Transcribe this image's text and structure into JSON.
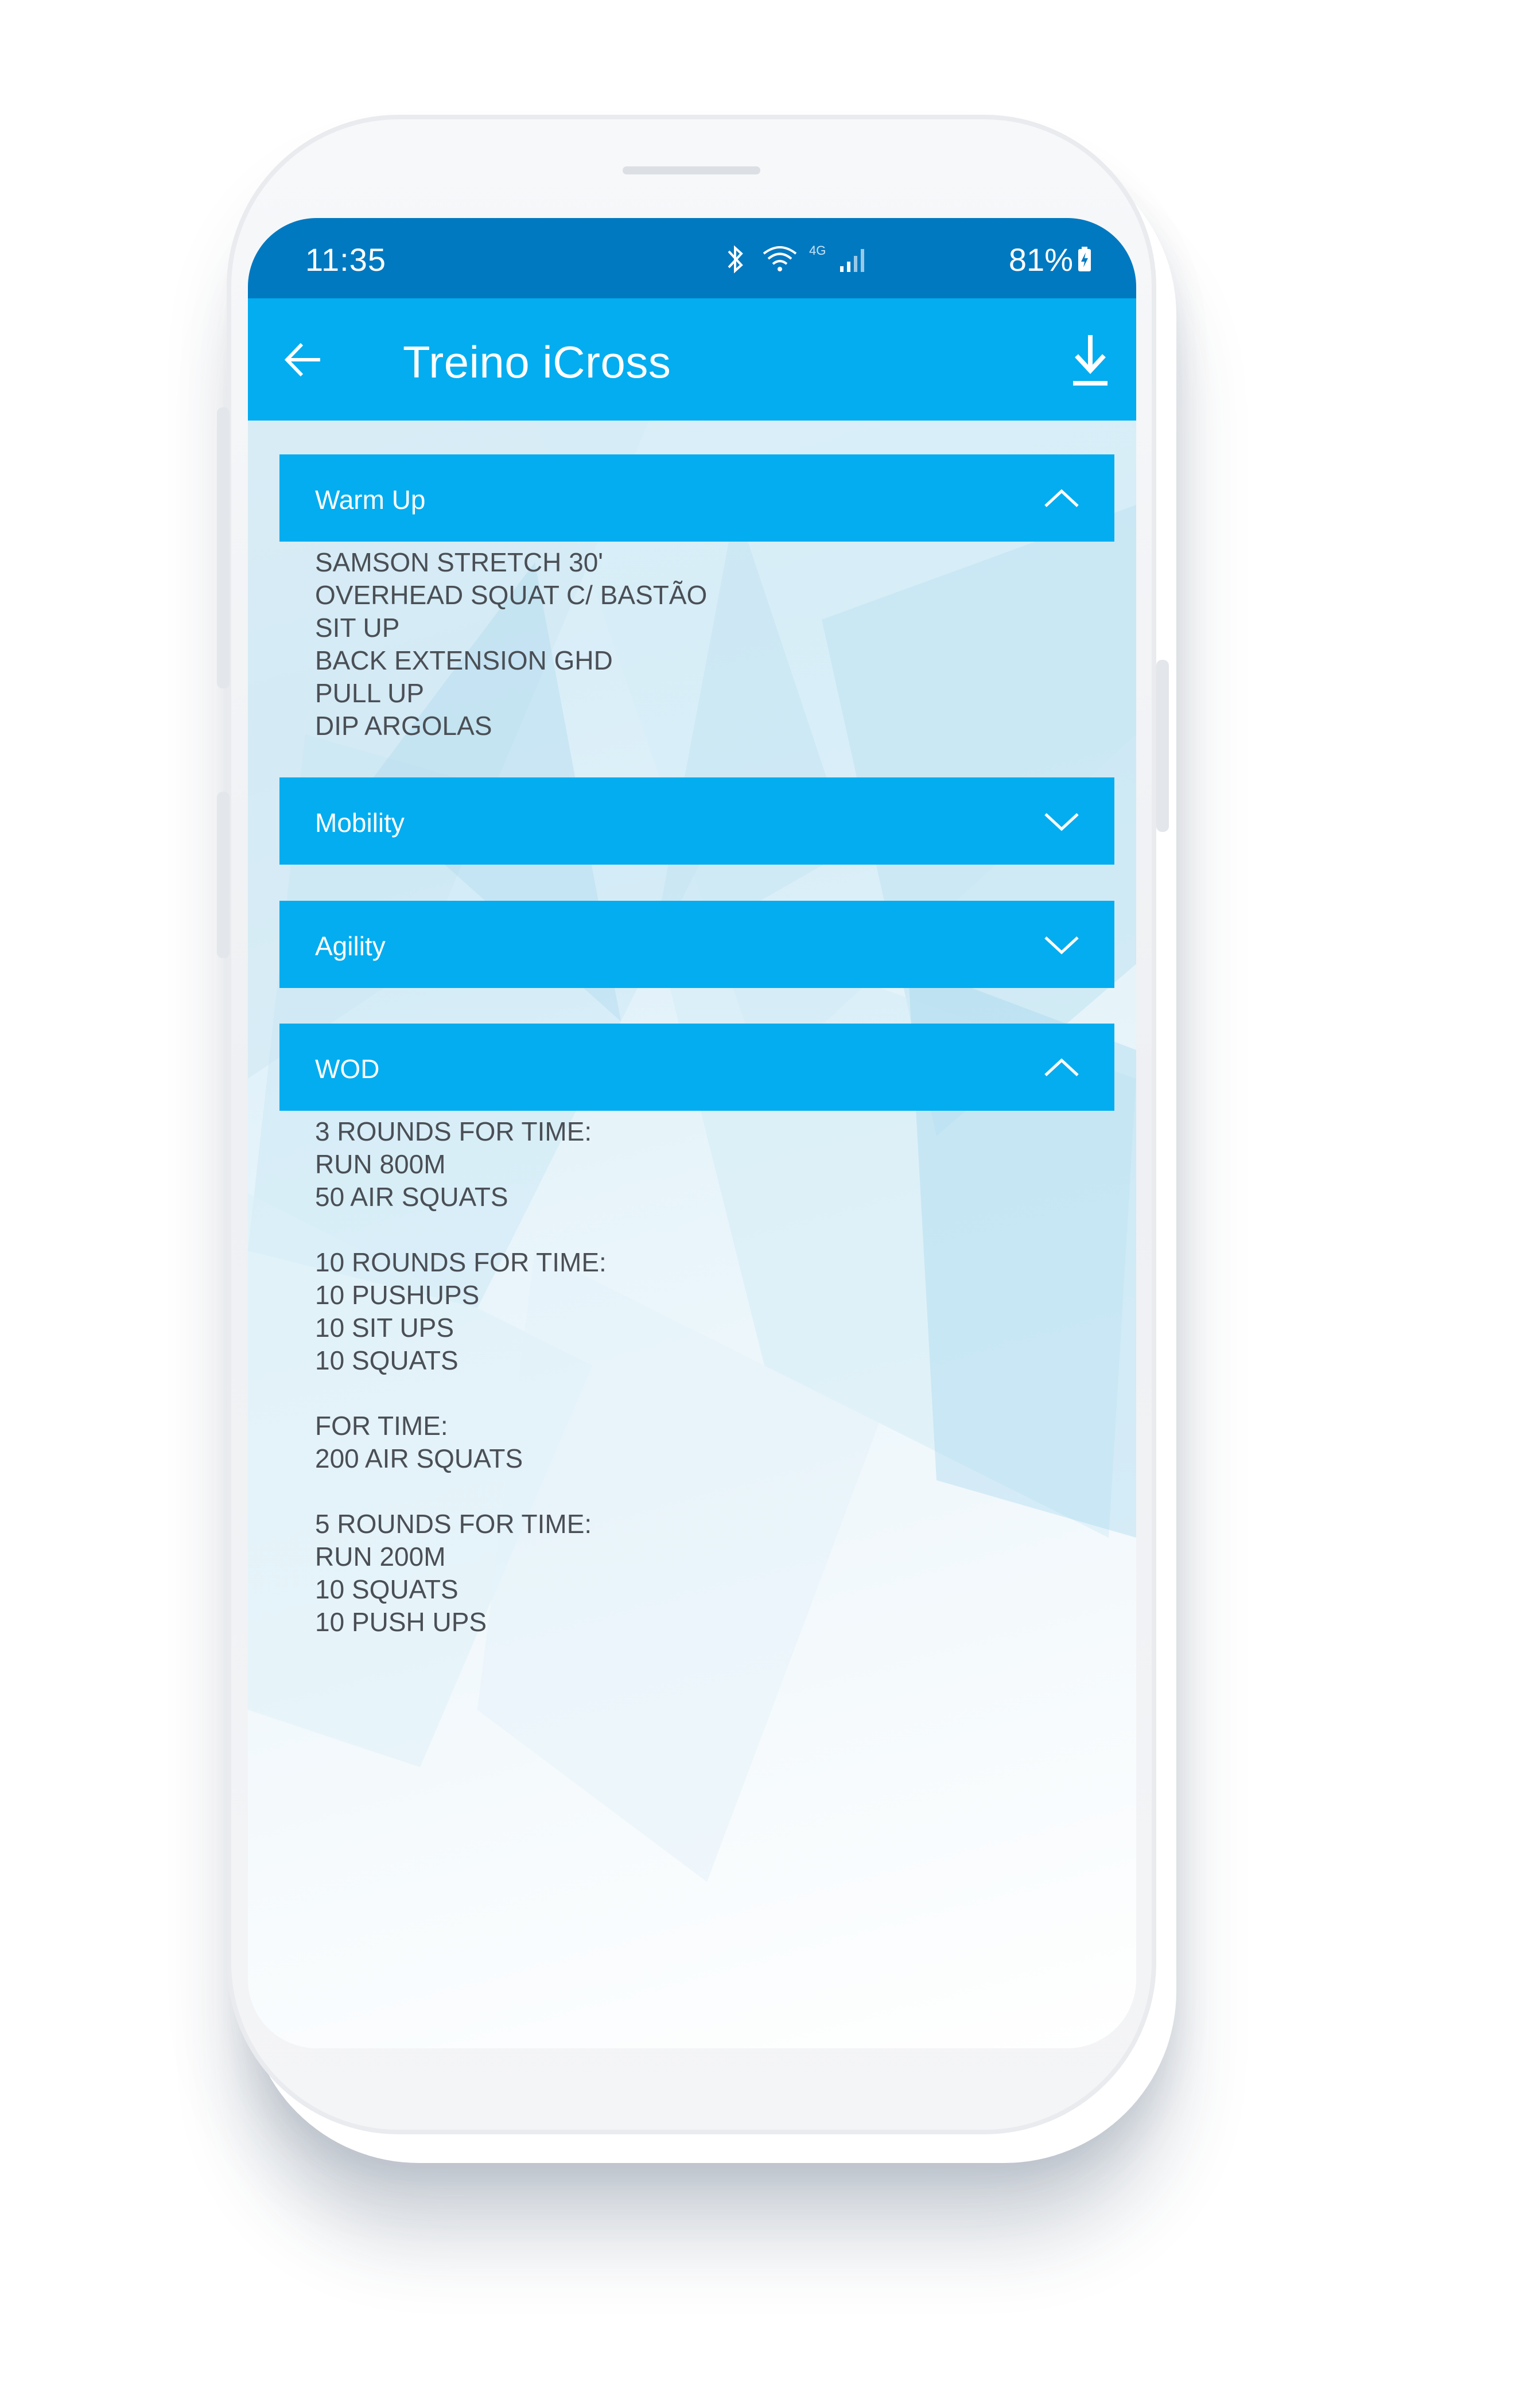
{
  "status_bar": {
    "time": "11:35",
    "network": "4G",
    "battery": "81%"
  },
  "app_bar": {
    "title": "Treino iCross",
    "back_icon": "arrow-left-icon",
    "action_icon": "download-icon"
  },
  "sections": [
    {
      "title": "Warm Up",
      "expanded": true,
      "lines": [
        "SAMSON STRETCH 30'",
        "OVERHEAD SQUAT C/ BASTÃO",
        "SIT UP",
        "BACK EXTENSION GHD",
        "PULL UP",
        "DIP ARGOLAS"
      ]
    },
    {
      "title": "Mobility",
      "expanded": false,
      "lines": []
    },
    {
      "title": "Agility",
      "expanded": false,
      "lines": []
    },
    {
      "title": "WOD",
      "expanded": true,
      "lines": [
        "3 ROUNDS FOR TIME:",
        "RUN 800M",
        "50 AIR SQUATS",
        "",
        "10 ROUNDS FOR TIME:",
        "10 PUSHUPS",
        "10 SIT UPS",
        "10 SQUATS",
        "",
        "FOR TIME:",
        "200 AIR SQUATS",
        "",
        "5 ROUNDS FOR TIME:",
        "RUN 200M",
        "10 SQUATS",
        "10 PUSH UPS"
      ]
    }
  ],
  "colors": {
    "status_bar": "#0179c1",
    "app_bar": "#03adef",
    "section_header": "#03adef",
    "body_text": "#4a4f55"
  }
}
